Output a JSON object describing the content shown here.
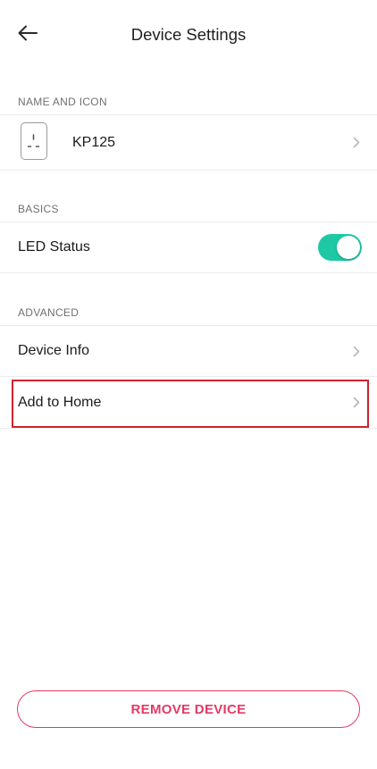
{
  "header": {
    "title": "Device Settings",
    "back_icon": "arrow-left-icon"
  },
  "sections": {
    "name_and_icon": {
      "label": "NAME AND ICON",
      "device_name": "KP125",
      "device_icon": "smart-plug-icon"
    },
    "basics": {
      "label": "BASICS",
      "led_status_label": "LED Status",
      "led_status_on": true
    },
    "advanced": {
      "label": "ADVANCED",
      "device_info_label": "Device Info",
      "add_to_home_label": "Add to Home"
    }
  },
  "footer": {
    "remove_label": "REMOVE DEVICE"
  },
  "colors": {
    "accent_toggle": "#1ec8a5",
    "remove_red": "#e23a66",
    "highlight_red": "#d0232f"
  }
}
